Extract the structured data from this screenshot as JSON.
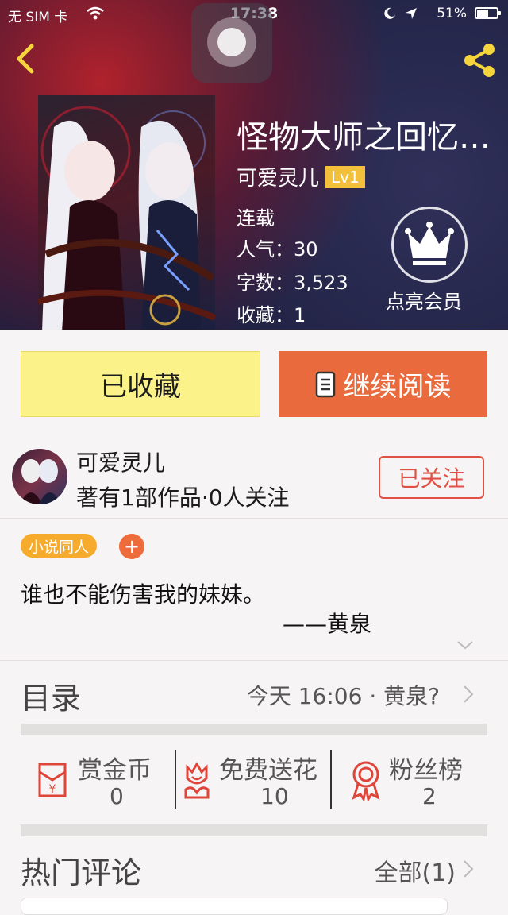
{
  "status_bar": {
    "carrier": "无 SIM 卡",
    "time": "17:38",
    "battery": "51%"
  },
  "book": {
    "title": "怪物大师之回忆…",
    "author": "可爱灵儿",
    "level": "Lv1",
    "status": "连载",
    "popularity": "人气：30",
    "word_count": "字数：3,523",
    "favorites": "收藏：1",
    "vip_label": "点亮会员"
  },
  "actions": {
    "favorited_label": "已收藏",
    "read_label": "继续阅读"
  },
  "author_card": {
    "name": "可爱灵儿",
    "stats": "著有1部作品·0人关注",
    "follow_label": "已关注"
  },
  "tags": [
    "小说同人"
  ],
  "tag_add": "+",
  "description": {
    "line1": "谁也不能伤害我的妹妹。",
    "line2": "——黄泉"
  },
  "toc": {
    "label": "目录",
    "latest": "今天 16:06 · 黄泉?"
  },
  "stats": [
    {
      "label": "赏金币",
      "value": "0",
      "icon": "red-envelope-icon"
    },
    {
      "label": "免费送花",
      "value": "10",
      "icon": "flower-icon"
    },
    {
      "label": "粉丝榜",
      "value": "2",
      "icon": "medal-icon"
    }
  ],
  "comments": {
    "label": "热门评论",
    "all_label": "全部(1)"
  },
  "colors": {
    "accent_orange": "#e96a3d",
    "fav_yellow": "#fbf28a",
    "follow_red": "#e05044",
    "icon_red": "#e0453a"
  }
}
